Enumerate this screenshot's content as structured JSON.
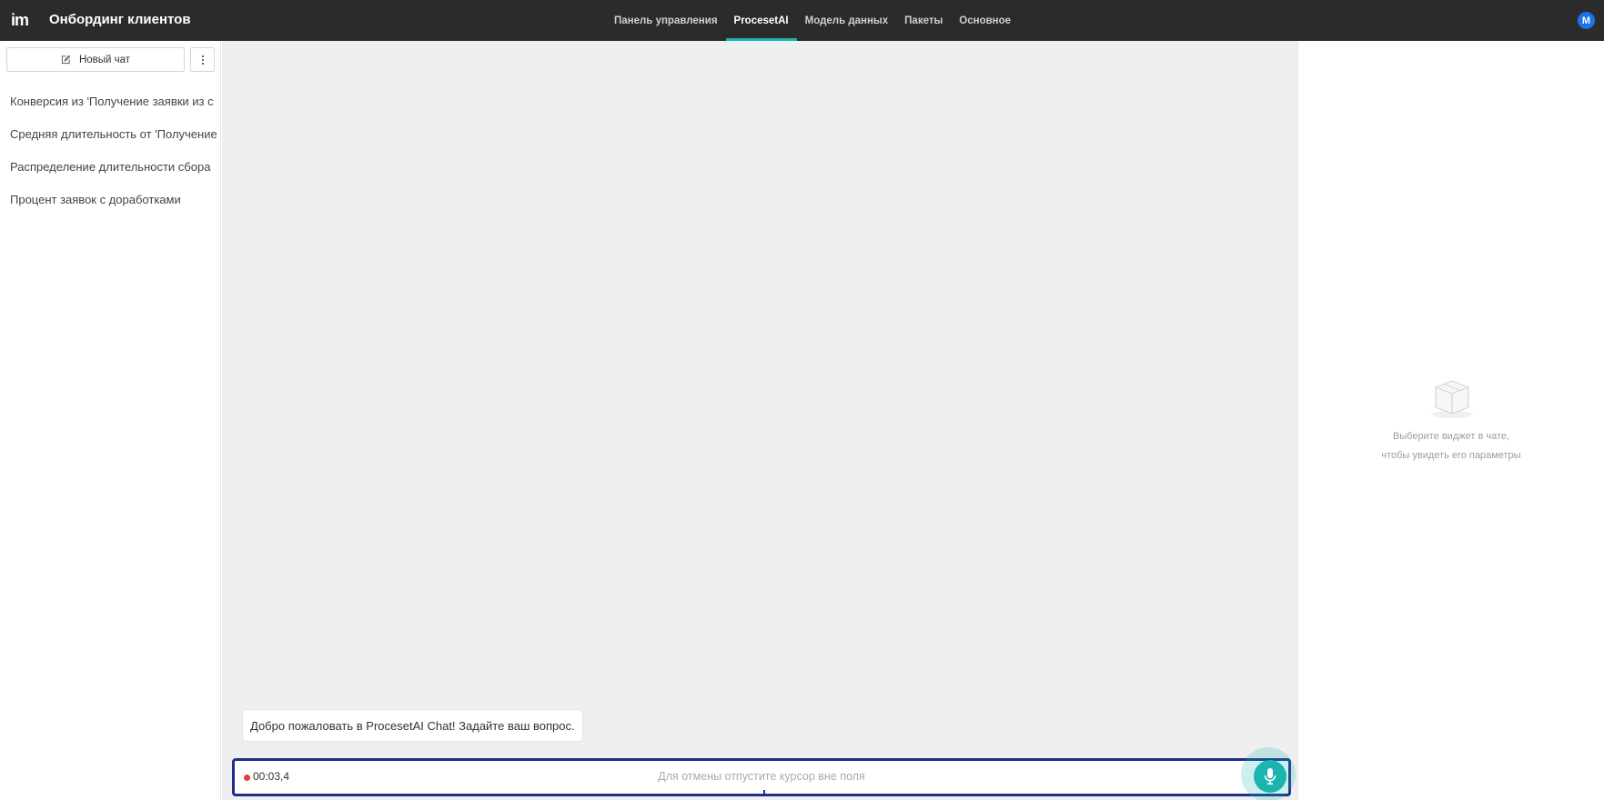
{
  "app": {
    "logo": "im",
    "title": "Онбординг клиентов",
    "avatar_initial": "M"
  },
  "nav": {
    "tabs": [
      {
        "label": "Панель управления",
        "active": false
      },
      {
        "label": "ProcesetAI",
        "active": true
      },
      {
        "label": "Модель данных",
        "active": false
      },
      {
        "label": "Пакеты",
        "active": false
      },
      {
        "label": "Основное",
        "active": false
      }
    ]
  },
  "sidebar": {
    "new_chat_label": "Новый чат",
    "chats": [
      {
        "label": "Конверсия из 'Получение заявки из с"
      },
      {
        "label": "Средняя длительность от 'Получение"
      },
      {
        "label": "Распределение длительности сбора"
      },
      {
        "label": "Процент заявок с доработками"
      }
    ]
  },
  "main": {
    "welcome_message": "Добро пожаловать в ProcesetAI Chat! Задайте ваш вопрос.",
    "recording": {
      "timer": "00:03,4",
      "hint": "Для отмены отпустите курсор вне поля"
    }
  },
  "right_panel": {
    "empty_line1": "Выберите виджет в чате,",
    "empty_line2": "чтобы увидеть его параметры"
  },
  "colors": {
    "topbar": "#2b2b2b",
    "accent": "#1bb5b0",
    "input_border": "#1d2f8a",
    "record": "#e53935",
    "avatar": "#1a73e8"
  },
  "icons": [
    "edit-icon",
    "more-vertical-icon",
    "microphone-icon",
    "empty-box-icon"
  ]
}
